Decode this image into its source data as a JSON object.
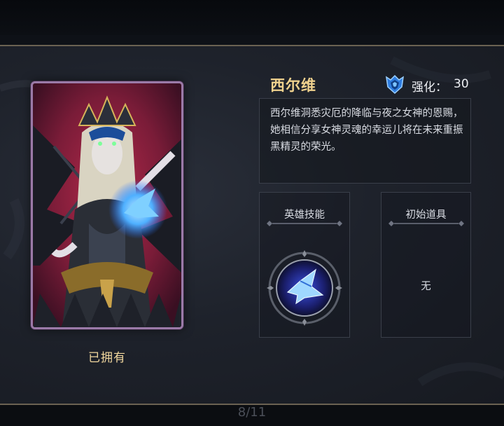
{
  "hero": {
    "name": "西尔维",
    "enhance_label": "强化：",
    "enhance_value": "30",
    "description": "西尔维洞悉灾厄的降临与夜之女神的恩赐，她相信分享女神灵魂的幸运儿将在未来重振黑精灵的荣光。",
    "status": "已拥有"
  },
  "skill": {
    "title": "英雄技能",
    "icon": "blue-bird-skill-icon"
  },
  "starting_item": {
    "title": "初始道具",
    "value": "无"
  },
  "pagination": {
    "text": "8/11"
  },
  "colors": {
    "accent_gold": "#f0d28e",
    "card_border": "#9b7aa8",
    "panel_bg": "#1e222b",
    "skill_blue": "#3f7bff"
  }
}
